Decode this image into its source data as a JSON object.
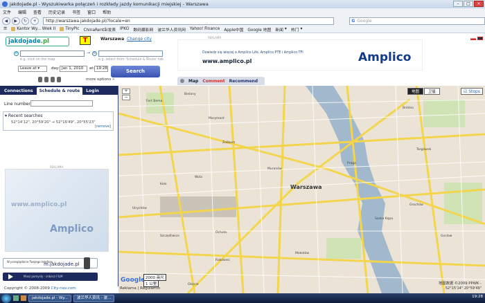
{
  "window": {
    "title": "jakdojade.pl - Wyszukiwarka połączeń i rozkłady jazdy komunikacji miejskiej - Warszawa"
  },
  "menu": [
    "文件",
    "编辑",
    "查看",
    "历史记录",
    "书签",
    "窗口",
    "帮助"
  ],
  "browser": {
    "url": "http://warszawa.jakdojade.pl/?locale=en",
    "search_placeholder": "Google"
  },
  "bookmarks": [
    "Kantor Wy... Wiek II",
    "TinyPic",
    "ChinaRentål发表",
    "IPKO",
    "数码摄影网",
    "波兰华人资讯网",
    "Yahoo! Finance",
    "Apple中国",
    "Google 地图",
    "新闻",
    "热门"
  ],
  "header": {
    "logo_text": "jakdojade",
    "logo_suffix": ".pl",
    "city": "Warszawa",
    "change_city": "Change city",
    "hint_a": "e.g. click on the map",
    "hint_b": "e.g. select from 'Schedule & Route' tab",
    "time_mode": "Leave at",
    "day_label": "day:",
    "day_value": "Jan 1, 2010",
    "at_label": "at:",
    "time_value": "19:28",
    "search_button": "Search",
    "more_options": "more options",
    "ad_label": "REKLAMA",
    "ad_line1": "Dowiedz się więcej o Amplico Life, Amplico PTE i Amplico TFI",
    "ad_line2": "www.amplico.pl",
    "ad_brand": "Amplico",
    "map_tabs": {
      "map": "Map",
      "comment": "Comment",
      "recommend": "Recommend"
    }
  },
  "panel": {
    "tabs": [
      "Connections",
      "Schedule & route",
      "Login"
    ],
    "active_tab": 1,
    "line_number_label": "Line number",
    "recent_header": "Recent searches",
    "recent_item": "52°14'12\", 20°59'20\" → 52°16'49\", 20°55'23\"",
    "remove": "[remove]",
    "ad_label": "REKLAMA",
    "ad_www": "www.amplico.pl",
    "ad_brand": "Amplico",
    "promo1_text": "W przeglądarce Twojego telefonu",
    "promo1_brand": "m.jakdojade.pl",
    "promo2_text": "Masz pomysły - zobacz FILM"
  },
  "footer": {
    "copyright": "Copyright © 2008-2009",
    "partner": "City-nav.com"
  },
  "map": {
    "types": [
      "地图",
      "卫星"
    ],
    "active_type": 0,
    "stops": "Stops",
    "city_label": "Warszawa",
    "districts": [
      "Fort Bema",
      "Bielany",
      "Marymont",
      "Żoliborz",
      "Muranów",
      "Wola",
      "Koło",
      "Ulrychów",
      "Ochota",
      "Szczęśliwice",
      "Mokotów",
      "Praga",
      "Targówek",
      "Bródno",
      "Grochów",
      "Gocław",
      "Saska Kępa",
      "Rakowiec",
      "Okęcie"
    ],
    "scale_km": "2000 英尺",
    "scale_m": "1 公里",
    "copyright": "地图数据 ©2009 PPWK -",
    "coords": "52°15'14\" 20°59'49\"",
    "reklama": "Reklama",
    "regulamin": "Regulamin",
    "brand": "Google"
  },
  "taskbar": {
    "items": [
      "jakdojade.pl - Wy...",
      "波兰华人资讯 - 波..."
    ],
    "clock": "19:28"
  }
}
